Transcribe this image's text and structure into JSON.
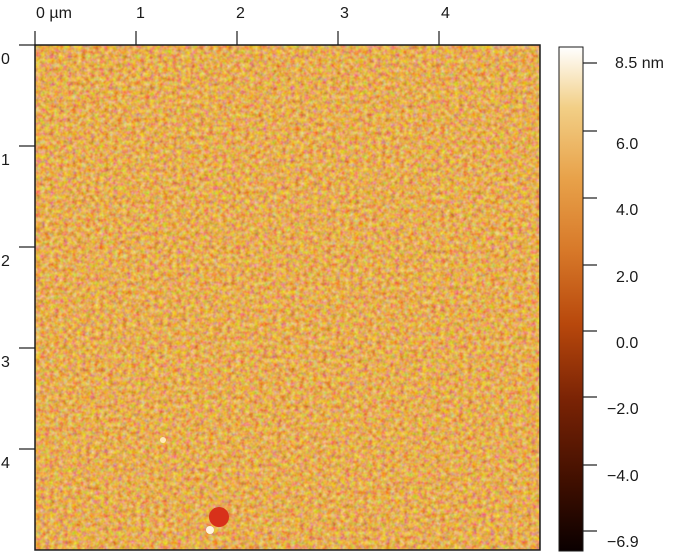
{
  "image": {
    "kind": "AFM height map",
    "colormap": "afmhot",
    "colormap_stops": [
      "#0a0000",
      "#3d0e00",
      "#7a2305",
      "#b8480c",
      "#d87a2a",
      "#e8a24a",
      "#f2cf86",
      "#ffffff"
    ],
    "background_color": "#c45a1a"
  },
  "x_axis": {
    "ticks": [
      "0 µm",
      "1",
      "2",
      "3",
      "4"
    ]
  },
  "y_axis": {
    "ticks": [
      "0",
      "1",
      "2",
      "3",
      "4"
    ]
  },
  "colorbar": {
    "labels": [
      "8.5 nm",
      "6.0",
      "4.0",
      "2.0",
      "0.0",
      "−2.0",
      "−4.0",
      "−6.9"
    ],
    "max": 8.5,
    "min": -6.9,
    "unit": "nm"
  }
}
